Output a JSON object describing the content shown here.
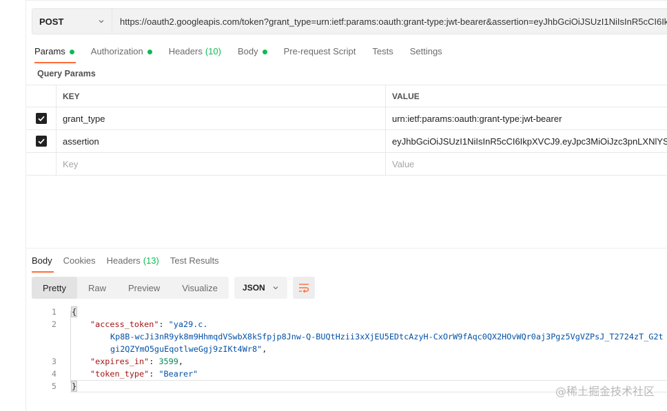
{
  "request": {
    "method": "POST",
    "url": "https://oauth2.googleapis.com/token?grant_type=urn:ietf:params:oauth:grant-type:jwt-bearer&assertion=eyJhbGciOiJSUzI1NiIsInR5cCI6IkpXVCJ9",
    "tabs": [
      {
        "label": "Params",
        "dot": true
      },
      {
        "label": "Authorization",
        "dot": true
      },
      {
        "label": "Headers",
        "count": "(10)"
      },
      {
        "label": "Body",
        "dot": true
      },
      {
        "label": "Pre-request Script"
      },
      {
        "label": "Tests"
      },
      {
        "label": "Settings"
      }
    ]
  },
  "query_params": {
    "title": "Query Params",
    "header": {
      "key": "KEY",
      "value": "VALUE"
    },
    "rows": [
      {
        "key": "grant_type",
        "value": "urn:ietf:params:oauth:grant-type:jwt-bearer"
      },
      {
        "key": "assertion",
        "value": "eyJhbGciOiJSUzI1NiIsInR5cCI6IkpXVCJ9.eyJpc3MiOiJzc3pnLXNlYS0xN"
      }
    ],
    "placeholder": {
      "key": "Key",
      "value": "Value"
    }
  },
  "response": {
    "tabs": [
      {
        "label": "Body"
      },
      {
        "label": "Cookies"
      },
      {
        "label": "Headers",
        "count": "(13)"
      },
      {
        "label": "Test Results"
      }
    ],
    "views": [
      "Pretty",
      "Raw",
      "Preview",
      "Visualize"
    ],
    "format": "JSON",
    "code": {
      "line_numbers": [
        "1",
        "2",
        "3",
        "4",
        "5"
      ],
      "open_brace": "{",
      "close_brace": "}",
      "access_token_key": "\"access_token\"",
      "access_token_part1": "\"ya29.c.",
      "access_token_part2": "Kp8B-wcJi3nR9yk8m9HhmqdVSwbX8kSfpjp8Jnw-Q-BUQtHzii3xXjEU5EDtcAzyH-CxOrW9fAqc0QX2HOvWQr0aj3Pgz5VgVZPsJ_T2724zT_G2t",
      "access_token_part3": "gi2QZYmO5guEqotlweGgj9zIKt4Wr8\"",
      "expires_in_key": "\"expires_in\"",
      "expires_in_value": "3599",
      "token_type_key": "\"token_type\"",
      "token_type_value": "\"Bearer\""
    }
  },
  "watermark": "@稀土掘金技术社区",
  "colors": {
    "accent": "#ff6c37",
    "success": "#0cbb52"
  }
}
